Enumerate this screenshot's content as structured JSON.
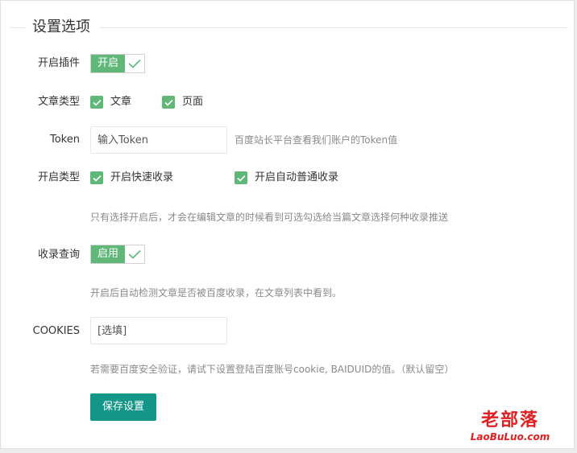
{
  "legend": "设置选项",
  "rows": {
    "plugin": {
      "label": "开启插件",
      "switch_text": "开启"
    },
    "article_type": {
      "label": "文章类型",
      "options": [
        "文章",
        "页面"
      ]
    },
    "token": {
      "label": "Token",
      "placeholder": "输入Token",
      "hint": "百度站长平台查看我们账户的Token值"
    },
    "open_type": {
      "label": "开启类型",
      "options": [
        "开启快速收录",
        "开启自动普通收录"
      ],
      "hint": "只有选择开启后，才会在编辑文章的时候看到可选勾选给当篇文章选择何种收录推送"
    },
    "query": {
      "label": "收录查询",
      "switch_text": "启用",
      "hint": "开启后自动检测文章是否被百度收录，在文章列表中看到。"
    },
    "cookies": {
      "label": "COOKIES",
      "placeholder": "[选填]",
      "hint": "若需要百度安全验证，请试下设置登陆百度账号cookie, BAIDUID的值。（默认留空）"
    }
  },
  "save_button": "保存设置",
  "watermark": {
    "cn": "老部落",
    "en": "LaoBuLuo.com"
  },
  "colors": {
    "switch_green": "#5fb878",
    "button_teal": "#139688",
    "watermark_red": "#e02020"
  }
}
